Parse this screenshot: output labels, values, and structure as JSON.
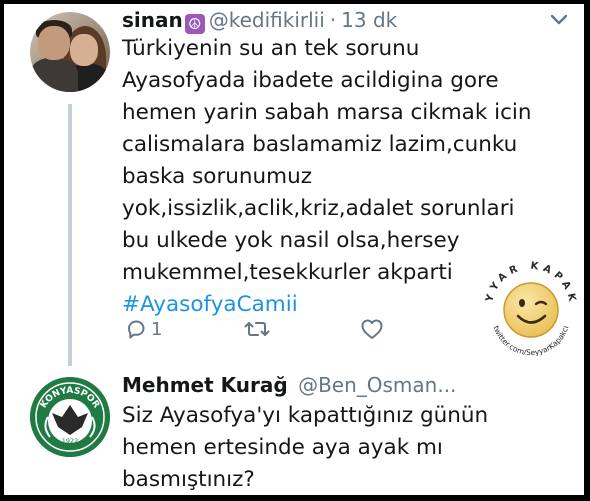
{
  "tweet": {
    "author_name": "sinan",
    "author_emoji": "☮",
    "handle": "@kedifikirlii",
    "separator": "·",
    "time": "13 dk",
    "text_lines": [
      "Türkiyenin su an  tek sorunu",
      "Ayasofyada  ibadete acildigina gore",
      "hemen yarin sabah marsa cikmak icin",
      "calismalara baslamamiz lazim,cunku",
      "baska sorunumuz",
      "yok,issizlik,aclik,kriz,adalet sorunlari",
      "bu ulkede yok nasil olsa,hersey",
      "mukemmel,tesekkurler akparti"
    ],
    "hashtag": "#AyasofyaCamii",
    "reply_count": "1",
    "retweet_count": "",
    "like_count": ""
  },
  "watermark": {
    "top_text": "SEYYAR KAPAKÇI",
    "bottom_text": "twitter.com/SeyyarKapakci"
  },
  "reply": {
    "author_name": "Mehmet Kurağ",
    "handle": "@Ben_Osman...",
    "avatar_club_text": "KONYASPOR",
    "avatar_year": "1922",
    "text_lines": [
      "Siz Ayasofya'yı kapattığınız günün",
      "hemen ertesinde aya ayak mı",
      "basmıştınız?"
    ]
  },
  "colors": {
    "text": "#14171a",
    "secondary": "#657786",
    "hashtag": "#1b95e0",
    "thread_line": "#c4cfd6",
    "konyaspor_green": "#1f7a44"
  }
}
